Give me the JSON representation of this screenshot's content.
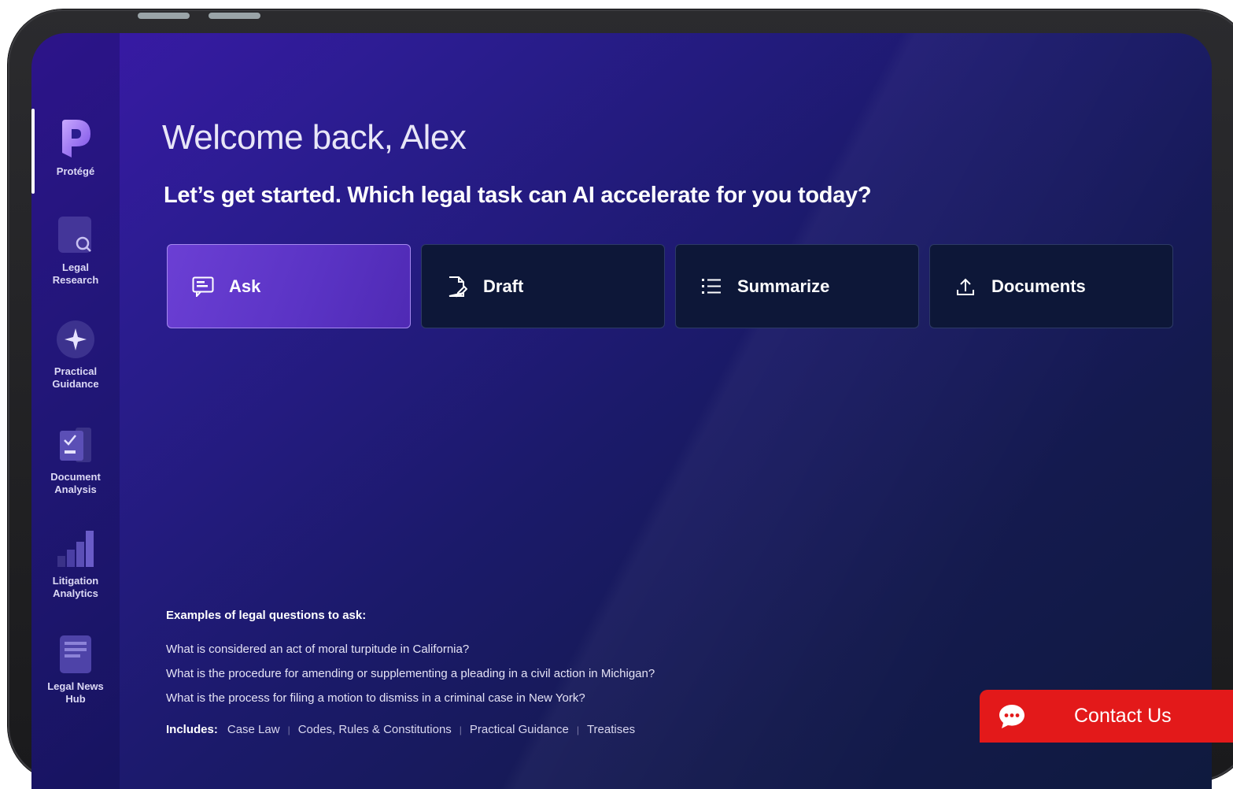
{
  "sidebar": {
    "items": [
      {
        "label": "Protégé",
        "icon": "protege-logo-icon"
      },
      {
        "label": "Legal\nResearch",
        "icon": "legal-research-icon"
      },
      {
        "label": "Practical\nGuidance",
        "icon": "practical-guidance-icon"
      },
      {
        "label": "Document\nAnalysis",
        "icon": "document-analysis-icon"
      },
      {
        "label": "Litigation\nAnalytics",
        "icon": "litigation-analytics-icon"
      },
      {
        "label": "Legal News\nHub",
        "icon": "legal-news-icon"
      }
    ]
  },
  "main": {
    "welcome": "Welcome back, Alex",
    "subtitle": "Let’s get started. Which legal task can AI accelerate for you today?",
    "tasks": [
      {
        "label": "Ask",
        "icon": "chat-icon",
        "active": true
      },
      {
        "label": "Draft",
        "icon": "draft-icon",
        "active": false
      },
      {
        "label": "Summarize",
        "icon": "list-icon",
        "active": false
      },
      {
        "label": "Documents",
        "icon": "upload-icon",
        "active": false
      }
    ],
    "examples": {
      "title": "Examples of legal questions to ask:",
      "questions": [
        "What is considered an act of moral turpitude in California?",
        "What is the procedure for amending or supplementing a pleading in a civil action in Michigan?",
        "What is the process for filing a motion to dismiss in a criminal case in New York?"
      ]
    },
    "includes": {
      "label": "Includes:",
      "items": [
        "Case Law",
        "Codes, Rules & Constitutions",
        "Practical Guidance",
        "Treatises"
      ]
    }
  },
  "contact": {
    "label": "Contact Us",
    "icon": "chat-bubble-icon",
    "color": "#e3191a"
  },
  "colors": {
    "accent": "#6b3fd4",
    "task_bg": "#0d1738",
    "contact": "#e3191a"
  }
}
